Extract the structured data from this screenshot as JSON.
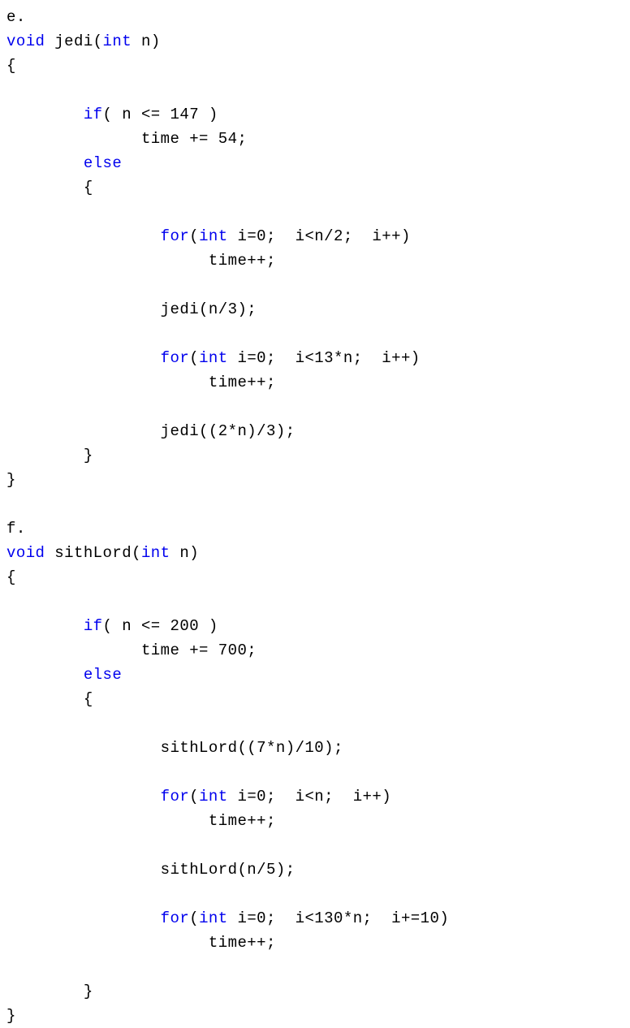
{
  "document": {
    "type": "code-listing",
    "language": "C++",
    "background_color": "#ffffff",
    "text_color": "#000000",
    "keyword_color": "#0000ee",
    "sections": [
      {
        "label": "e.",
        "function_name": "jedi"
      },
      {
        "label": "f.",
        "function_name": "sithLord"
      }
    ]
  },
  "lines": [
    {
      "id": 1,
      "indent": 0,
      "tokens": [
        {
          "t": "e.",
          "k": false
        }
      ]
    },
    {
      "id": 2,
      "indent": 0,
      "tokens": [
        {
          "t": "void",
          "k": true
        },
        {
          "t": " jedi(",
          "k": false
        },
        {
          "t": "int",
          "k": true
        },
        {
          "t": " n)",
          "k": false
        }
      ]
    },
    {
      "id": 3,
      "indent": 0,
      "tokens": [
        {
          "t": "{",
          "k": false
        }
      ]
    },
    {
      "id": 4,
      "indent": 0,
      "tokens": []
    },
    {
      "id": 5,
      "indent": 8,
      "tokens": [
        {
          "t": "if",
          "k": true
        },
        {
          "t": "( n <= 147 )",
          "k": false
        }
      ]
    },
    {
      "id": 6,
      "indent": 14,
      "tokens": [
        {
          "t": "time += 54;",
          "k": false
        }
      ]
    },
    {
      "id": 7,
      "indent": 8,
      "tokens": [
        {
          "t": "else",
          "k": true
        }
      ]
    },
    {
      "id": 8,
      "indent": 8,
      "tokens": [
        {
          "t": "{",
          "k": false
        }
      ]
    },
    {
      "id": 9,
      "indent": 0,
      "tokens": []
    },
    {
      "id": 10,
      "indent": 16,
      "tokens": [
        {
          "t": "for",
          "k": true
        },
        {
          "t": "(",
          "k": false
        },
        {
          "t": "int",
          "k": true
        },
        {
          "t": " i=0;  i<n/2;  i++)",
          "k": false
        }
      ]
    },
    {
      "id": 11,
      "indent": 21,
      "tokens": [
        {
          "t": "time++;",
          "k": false
        }
      ]
    },
    {
      "id": 12,
      "indent": 0,
      "tokens": []
    },
    {
      "id": 13,
      "indent": 16,
      "tokens": [
        {
          "t": "jedi(n/3);",
          "k": false
        }
      ]
    },
    {
      "id": 14,
      "indent": 0,
      "tokens": []
    },
    {
      "id": 15,
      "indent": 16,
      "tokens": [
        {
          "t": "for",
          "k": true
        },
        {
          "t": "(",
          "k": false
        },
        {
          "t": "int",
          "k": true
        },
        {
          "t": " i=0;  i<13*n;  i++)",
          "k": false
        }
      ]
    },
    {
      "id": 16,
      "indent": 21,
      "tokens": [
        {
          "t": "time++;",
          "k": false
        }
      ]
    },
    {
      "id": 17,
      "indent": 0,
      "tokens": []
    },
    {
      "id": 18,
      "indent": 16,
      "tokens": [
        {
          "t": "jedi((2*n)/3);",
          "k": false
        }
      ]
    },
    {
      "id": 19,
      "indent": 8,
      "tokens": [
        {
          "t": "}",
          "k": false
        }
      ]
    },
    {
      "id": 20,
      "indent": 0,
      "tokens": [
        {
          "t": "}",
          "k": false
        }
      ]
    },
    {
      "id": 21,
      "indent": 0,
      "tokens": []
    },
    {
      "id": 22,
      "indent": 0,
      "tokens": [
        {
          "t": "f.",
          "k": false
        }
      ]
    },
    {
      "id": 23,
      "indent": 0,
      "tokens": [
        {
          "t": "void",
          "k": true
        },
        {
          "t": " sithLord(",
          "k": false
        },
        {
          "t": "int",
          "k": true
        },
        {
          "t": " n)",
          "k": false
        }
      ]
    },
    {
      "id": 24,
      "indent": 0,
      "tokens": [
        {
          "t": "{",
          "k": false
        }
      ]
    },
    {
      "id": 25,
      "indent": 0,
      "tokens": []
    },
    {
      "id": 26,
      "indent": 8,
      "tokens": [
        {
          "t": "if",
          "k": true
        },
        {
          "t": "( n <= 200 )",
          "k": false
        }
      ]
    },
    {
      "id": 27,
      "indent": 14,
      "tokens": [
        {
          "t": "time += 700;",
          "k": false
        }
      ]
    },
    {
      "id": 28,
      "indent": 8,
      "tokens": [
        {
          "t": "else",
          "k": true
        }
      ]
    },
    {
      "id": 29,
      "indent": 8,
      "tokens": [
        {
          "t": "{",
          "k": false
        }
      ]
    },
    {
      "id": 30,
      "indent": 0,
      "tokens": []
    },
    {
      "id": 31,
      "indent": 16,
      "tokens": [
        {
          "t": "sithLord((7*n)/10);",
          "k": false
        }
      ]
    },
    {
      "id": 32,
      "indent": 0,
      "tokens": []
    },
    {
      "id": 33,
      "indent": 16,
      "tokens": [
        {
          "t": "for",
          "k": true
        },
        {
          "t": "(",
          "k": false
        },
        {
          "t": "int",
          "k": true
        },
        {
          "t": " i=0;  i<n;  i++)",
          "k": false
        }
      ]
    },
    {
      "id": 34,
      "indent": 21,
      "tokens": [
        {
          "t": "time++;",
          "k": false
        }
      ]
    },
    {
      "id": 35,
      "indent": 0,
      "tokens": []
    },
    {
      "id": 36,
      "indent": 16,
      "tokens": [
        {
          "t": "sithLord(n/5);",
          "k": false
        }
      ]
    },
    {
      "id": 37,
      "indent": 0,
      "tokens": []
    },
    {
      "id": 38,
      "indent": 16,
      "tokens": [
        {
          "t": "for",
          "k": true
        },
        {
          "t": "(",
          "k": false
        },
        {
          "t": "int",
          "k": true
        },
        {
          "t": " i=0;  i<130*n;  i+=10)",
          "k": false
        }
      ]
    },
    {
      "id": 39,
      "indent": 21,
      "tokens": [
        {
          "t": "time++;",
          "k": false
        }
      ]
    },
    {
      "id": 40,
      "indent": 0,
      "tokens": []
    },
    {
      "id": 41,
      "indent": 8,
      "tokens": [
        {
          "t": "}",
          "k": false
        }
      ]
    },
    {
      "id": 42,
      "indent": 0,
      "tokens": [
        {
          "t": "}",
          "k": false
        }
      ]
    }
  ]
}
